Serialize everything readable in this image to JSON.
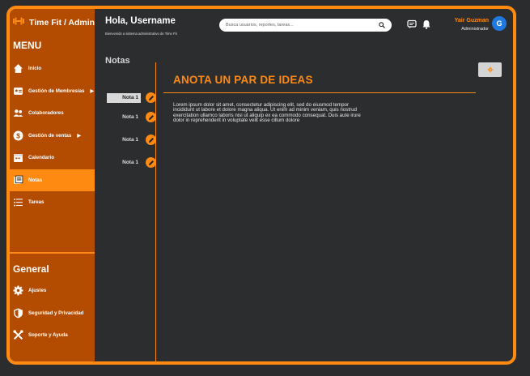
{
  "brand": {
    "title": "Time Fit / Admin",
    "icon": "dumbbell-icon"
  },
  "sidebar": {
    "menu_title": "MENU",
    "items": [
      {
        "label": "Inicio",
        "icon": "home-icon",
        "active": false
      },
      {
        "label": "Gestión de Membresías",
        "icon": "id-card-icon",
        "caret": "▶",
        "active": false
      },
      {
        "label": "Colaboradores",
        "icon": "users-icon",
        "active": false
      },
      {
        "label": "Gestión de ventas",
        "icon": "dollar-icon",
        "caret": "▶",
        "active": false
      },
      {
        "label": "Calendario",
        "icon": "calendar-icon",
        "active": false
      },
      {
        "label": "Notas",
        "icon": "notes-icon",
        "active": true
      },
      {
        "label": "Tareas",
        "icon": "tasks-icon",
        "active": false
      }
    ],
    "general_title": "General",
    "general_items": [
      {
        "label": "Ajustes",
        "icon": "gear-icon"
      },
      {
        "label": "Seguridad y Privacidad",
        "icon": "shield-icon"
      },
      {
        "label": "Soporte y Ayuda",
        "icon": "tools-icon"
      }
    ]
  },
  "header": {
    "greeting": "Hola, Username",
    "subtitle": "Bienvenido a sistema administrativo de Time Fit",
    "search_placeholder": "Busca usuarios, reportes, tareas...",
    "user_name": "Yair Guzman",
    "user_role": "Administrador",
    "avatar_letter": "G"
  },
  "notes": {
    "column_title": "Notas",
    "list": [
      {
        "label": "Nota 1",
        "active": true
      },
      {
        "label": "Nota 1",
        "active": false
      },
      {
        "label": "Nota 1",
        "active": false
      },
      {
        "label": "Nota 1",
        "active": false
      }
    ],
    "current_title": "ANOTA UN PAR DE IDEAS",
    "current_body": "Lorem ipsum dolor sit amet, consectetur adipiscing elit, sed do eiusmod tempor incididunt ut labore et dolore magna aliqua. Ut enim ad minim veniam, quis nostrud exercitation ullamco laboris nisi ut aliquip ex ea commodo consequat. Duis aute irure dolor in reprehenderit in voluptate velit esse cillum dolore"
  },
  "colors": {
    "accent": "#ff8a12",
    "sidebar": "#b34b00",
    "background": "#2c2d2f",
    "avatar": "#1f7ae0"
  }
}
